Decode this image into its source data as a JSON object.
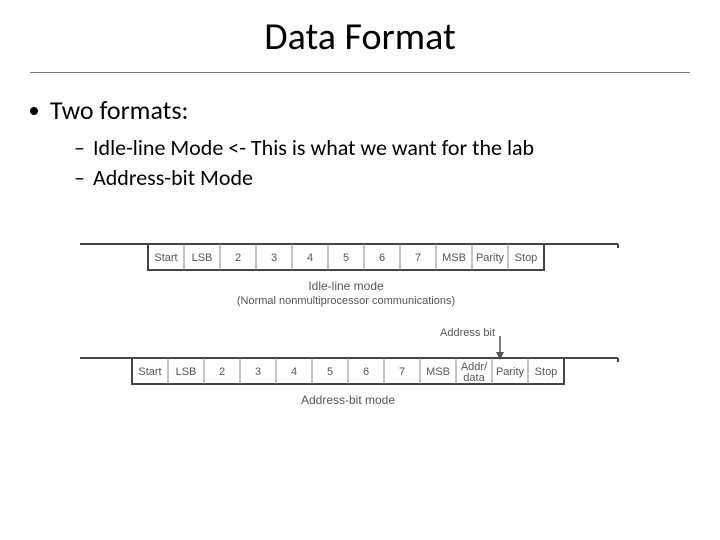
{
  "title": "Data Format",
  "bullet_main": "Two formats:",
  "sub_items": [
    "Idle-line Mode <- This is what we want for the lab",
    "Address-bit Mode"
  ],
  "diagram": {
    "idle": {
      "markers": [
        "Start",
        "LSB",
        "2",
        "3",
        "4",
        "5",
        "6",
        "7",
        "MSB",
        "Parity",
        "Stop"
      ],
      "mode_line1": "Idle-line mode",
      "mode_line2": "(Normal nonmultiprocessor communications)"
    },
    "addr": {
      "address_bit_label": "Address bit",
      "markers": [
        "Start",
        "LSB",
        "2",
        "3",
        "4",
        "5",
        "6",
        "7",
        "MSB",
        "Addr/\ndata",
        "Parity",
        "Stop"
      ],
      "mode_label": "Address-bit mode"
    }
  }
}
